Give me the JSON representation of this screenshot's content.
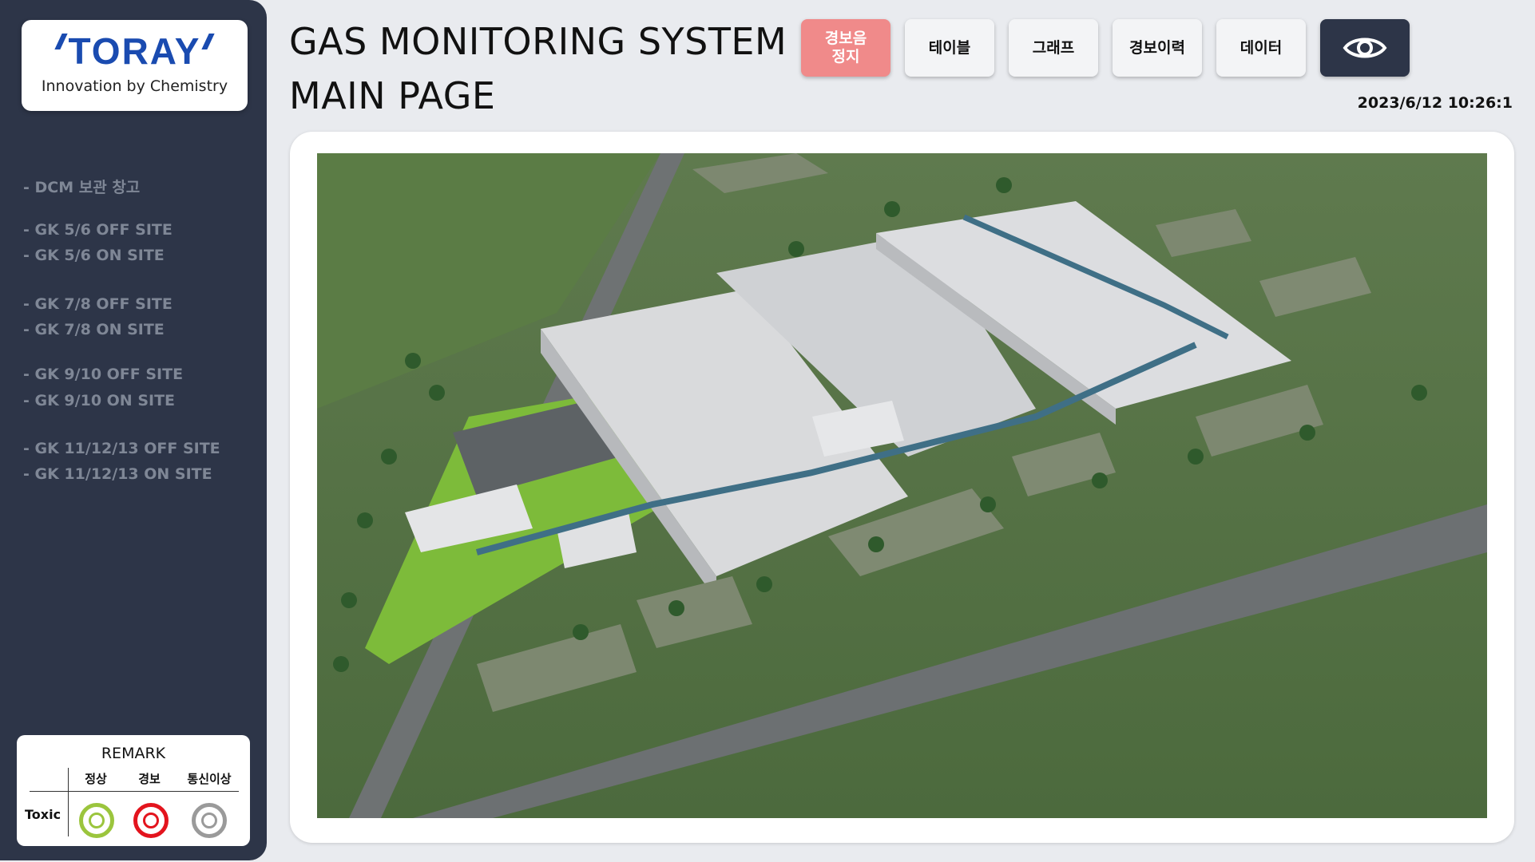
{
  "brand": {
    "logo_text": "TORAY",
    "tagline": "Innovation by Chemistry"
  },
  "sidebar": {
    "items": [
      {
        "label": "- DCM 보관 창고"
      },
      {
        "label": "- GK 5/6 OFF SITE"
      },
      {
        "label": "- GK 5/6 ON SITE"
      },
      {
        "label": "- GK 7/8 OFF SITE"
      },
      {
        "label": "- GK 7/8 ON SITE"
      },
      {
        "label": "- GK 9/10 OFF SITE"
      },
      {
        "label": "- GK 9/10 ON SITE"
      },
      {
        "label": "- GK 11/12/13 OFF SITE"
      },
      {
        "label": "- GK 11/12/13 ON SITE"
      }
    ]
  },
  "remark": {
    "title": "REMARK",
    "columns": [
      "정상",
      "경보",
      "통신이상"
    ],
    "row_label": "Toxic",
    "colors": {
      "normal": "#9bc53d",
      "alarm": "#e3141d",
      "comm_error": "#9a9a9a"
    }
  },
  "header": {
    "title_line1": "GAS MONITORING SYSTEM",
    "title_line2": "MAIN PAGE",
    "datetime": "2023/6/12 10:26:1"
  },
  "toolbar": {
    "alarm_stop_line1": "경보음",
    "alarm_stop_line2": "정지",
    "table": "테이블",
    "graph": "그래프",
    "alarm_history": "경보이력",
    "data": "데이터",
    "view_icon": "eye-icon"
  },
  "colors": {
    "sidebar_bg": "#2d3548",
    "alarm_button": "#f08a8a",
    "page_bg": "#e9ebef"
  }
}
